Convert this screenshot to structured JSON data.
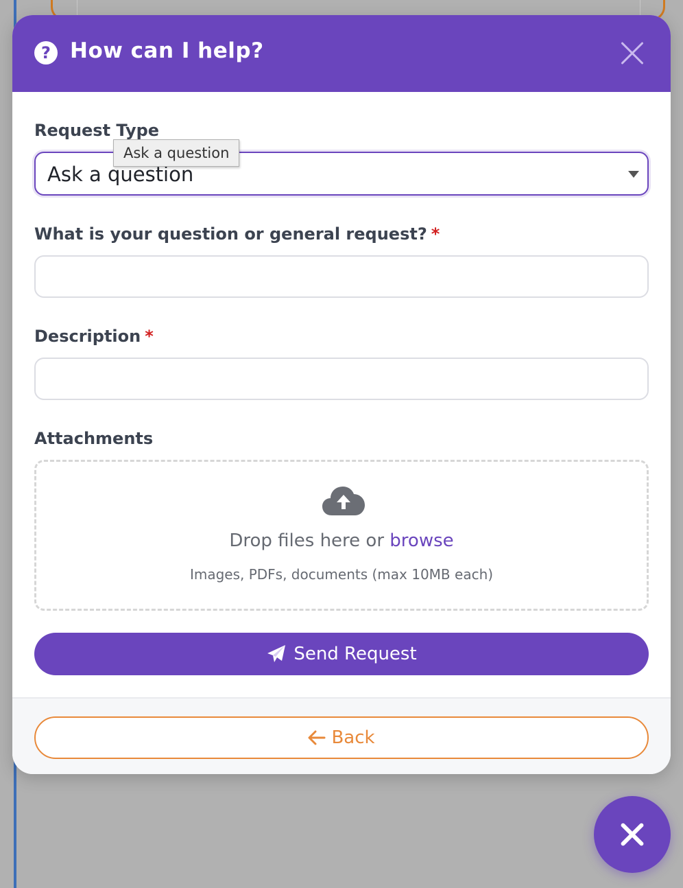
{
  "modal": {
    "title": "How can I help?",
    "help_icon": "question-circle-icon",
    "close_icon": "close-icon"
  },
  "form": {
    "request_type": {
      "label": "Request Type",
      "selected": "Ask a question",
      "tooltip": "Ask a question"
    },
    "question": {
      "label": "What is your question or general request?",
      "required_mark": "*",
      "value": "",
      "placeholder": ""
    },
    "description": {
      "label": "Description",
      "required_mark": "*",
      "value": "",
      "placeholder": ""
    },
    "attachments": {
      "label": "Attachments",
      "drop_text": "Drop files here or",
      "browse_link": "browse",
      "hint": "Images, PDFs, documents (max 10MB each)",
      "icon": "cloud-upload-icon"
    },
    "send_button": {
      "label": "Send Request",
      "icon": "paper-plane-icon"
    }
  },
  "footer": {
    "back_button": {
      "label": "Back",
      "icon": "arrow-left-icon"
    }
  },
  "fab": {
    "icon": "close-icon"
  },
  "colors": {
    "primary": "#6a45bd",
    "accent_orange": "#e8893a",
    "required": "#d22020",
    "overlay": "#b1b1b1"
  }
}
